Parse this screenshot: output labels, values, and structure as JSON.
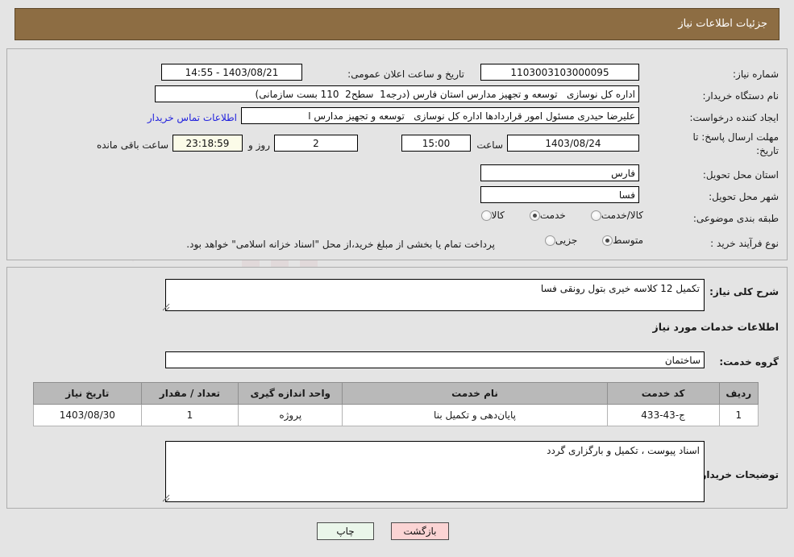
{
  "header": {
    "title": "جزئیات اطلاعات نیاز",
    "bar_color": "#8d6d43"
  },
  "top_form": {
    "need_number_label": "شماره نیاز:",
    "need_number_value": "1103003103000095",
    "announce_datetime_label": "تاریخ و ساعت اعلان عمومی:",
    "announce_datetime_value": "1403/08/21 - 14:55",
    "buyer_org_label": "نام دستگاه خریدار:",
    "buyer_org_value": "اداره کل نوسازی   توسعه و تجهیز مدارس استان فارس (درجه1  سطح2  110 بست سازمانی)",
    "requester_label": "ایجاد کننده درخواست:",
    "requester_value": "علیرضا حیدری مسئول امور قراردادها اداره کل نوسازی   توسعه و تجهیز مدارس ا",
    "buyer_contact_link": "اطلاعات تماس خریدار",
    "deadline_label_line1": "مهلت ارسال پاسخ: تا",
    "deadline_label_line2": "تاریخ:",
    "deadline_date": "1403/08/24",
    "deadline_hour_label": "ساعت",
    "deadline_time": "15:00",
    "remaining_days": "2",
    "remaining_days_suffix": "روز و",
    "remaining_clock": "23:18:59",
    "remaining_clock_suffix": "ساعت باقی مانده",
    "province_label": "استان محل تحویل:",
    "province_value": "فارس",
    "city_label": "شهر محل تحویل:",
    "city_value": "فسا",
    "category_label": "طبقه بندی موضوعی:",
    "category_options": [
      {
        "label": "کالا",
        "selected": false
      },
      {
        "label": "خدمت",
        "selected": true
      },
      {
        "label": "کالا/خدمت",
        "selected": false
      }
    ],
    "process_label": "نوع فرآیند خرید :",
    "process_options": [
      {
        "label": "جزیی",
        "selected": false
      },
      {
        "label": "متوسط",
        "selected": true
      }
    ],
    "payment_note": "پرداخت تمام یا بخشی از مبلغ خرید،از محل \"اسناد خزانه اسلامی\" خواهد بود."
  },
  "middle": {
    "general_desc_label": "شرح کلی نیاز:",
    "general_desc_value": "تکمیل 12 کلاسه خیری بتول رونقی فسا",
    "services_section_title": "اطلاعات خدمات مورد نیاز",
    "service_group_label": "گروه خدمت:",
    "service_group_value": "ساختمان",
    "table": {
      "columns": [
        "ردیف",
        "کد خدمت",
        "نام خدمت",
        "واحد اندازه گیری",
        "تعداد / مقدار",
        "تاریخ نیاز"
      ],
      "rows": [
        {
          "row_no": "1",
          "service_code": "ج-43-433",
          "service_name": "پایان‌دهی و تکمیل بنا",
          "unit": "پروژه",
          "quantity": "1",
          "need_date": "1403/08/30"
        }
      ]
    },
    "buyer_notes_label": "توضیحات خریدار:",
    "buyer_notes_value": "اسناد پیوست ، تکمیل و بارگزاری گردد"
  },
  "footer": {
    "print_label": "چاپ",
    "back_label": "بازگشت"
  },
  "watermark": {
    "text": "AnaTender.net"
  }
}
